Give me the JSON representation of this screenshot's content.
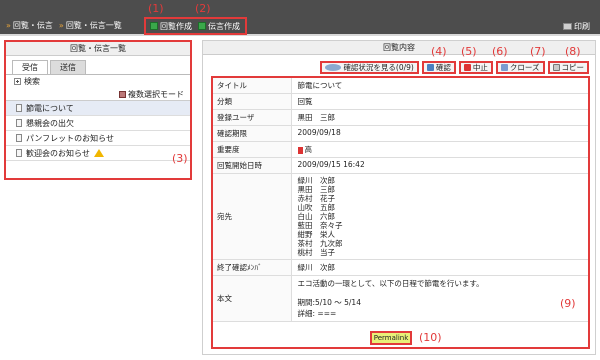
{
  "topbar": {
    "crumbs": [
      "回覧・伝言",
      "回覧・伝言一覧"
    ],
    "actions": [
      {
        "label": "回覧作成",
        "callout": "(1)"
      },
      {
        "label": "伝言作成",
        "callout": "(2)"
      }
    ],
    "print_label": "印刷"
  },
  "left": {
    "title": "回覧・伝言一覧",
    "tabs": [
      "受信",
      "送信"
    ],
    "search_label": "検索",
    "multiselect_label": "複数選択モード",
    "items": [
      "節電について",
      "懇親会の出欠",
      "パンフレットのお知らせ",
      "歓迎会のお知らせ"
    ],
    "callout": "(3)"
  },
  "right": {
    "title": "回覧内容",
    "buttons": [
      {
        "label": "確認状況を見る(0/9)",
        "icon": "search-icon",
        "callout": "(4)"
      },
      {
        "label": "確認",
        "icon": "check-icon",
        "callout": "(5)"
      },
      {
        "label": "中止",
        "icon": "stop-icon",
        "callout": "(6)"
      },
      {
        "label": "クローズ",
        "icon": "close-icon",
        "callout": "(7)"
      },
      {
        "label": "コピー",
        "icon": "copy-icon",
        "callout": "(8)"
      }
    ],
    "fields": {
      "title_label": "タイトル",
      "title_value": "節電について",
      "category_label": "分類",
      "category_value": "回覧",
      "user_label": "登録ユーザ",
      "user_value": "黒田　三郎",
      "deadline_label": "確認期限",
      "deadline_value": "2009/09/18",
      "priority_label": "重要度",
      "priority_value": "高",
      "start_label": "回覧開始日時",
      "start_value": "2009/09/15 16:42",
      "to_label": "宛先",
      "recipients": [
        "緑川　次郎",
        "黒田　三郎",
        "赤村　花子",
        "山吹　五郎",
        "白山　六郎",
        "藍田　奈々子",
        "紺野　栄人",
        "茶村　九次郎",
        "桃村　当子"
      ],
      "finished_label": "終了確認ﾒﾝﾊﾞ",
      "finished_value": "緑川　次郎",
      "body_label": "本文",
      "body_line1": "エコ活動の一環として、以下の日程で節電を行います。",
      "body_line2": "期間:5/10 ～ 5/14",
      "body_line3": "詳細: ===",
      "callout": "(9)"
    },
    "permalink_label": "Permalink",
    "permalink_callout": "(10)"
  },
  "colors": {
    "accent": "#e23a3a",
    "topbar": "#4d4d4d",
    "selected": "#e6ebf5"
  }
}
